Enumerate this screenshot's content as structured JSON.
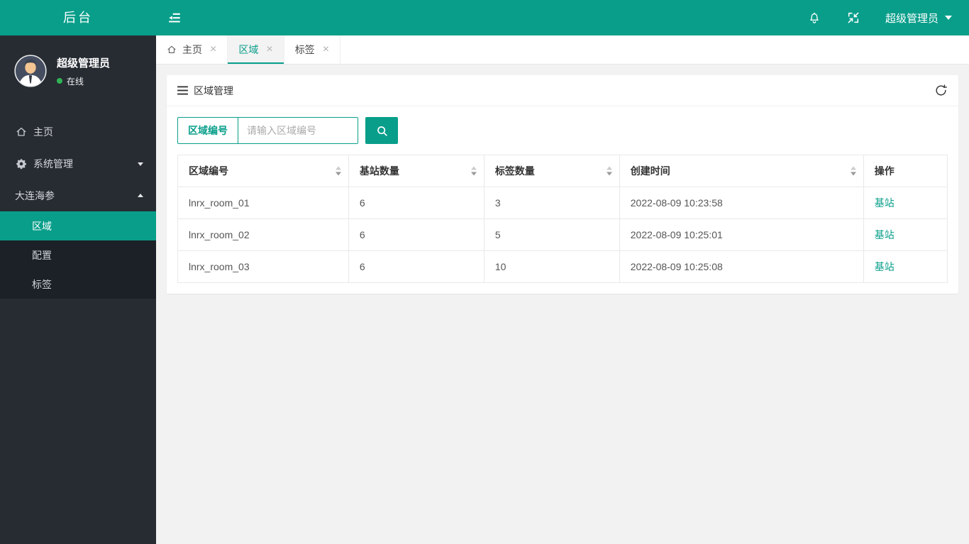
{
  "colors": {
    "accent": "#089e8a",
    "sidebar_bg": "#272c33",
    "submenu_bg": "#1c2127",
    "content_bg": "#f2f2f2",
    "online_dot_green": "#30b455",
    "link": "#089e8a"
  },
  "header": {
    "logo_text": "后台",
    "user_name": "超级管理员",
    "icons": [
      "sidebar-collapse-icon",
      "bell-icon",
      "exit-fullscreen-icon",
      "chevron-down-icon"
    ]
  },
  "sidebar": {
    "user": {
      "name": "超级管理员",
      "status": "在线"
    },
    "menu": [
      {
        "label": "主页",
        "icon": "home-icon"
      },
      {
        "label": "系统管理",
        "icon": "gear-icon",
        "state": "collapsed"
      },
      {
        "label": "大连海参",
        "state": "expanded",
        "children": [
          {
            "label": "区域",
            "active": true
          },
          {
            "label": "配置",
            "active": false
          },
          {
            "label": "标签",
            "active": false
          }
        ]
      }
    ]
  },
  "tabs": {
    "close_symbol": "×",
    "items": [
      {
        "label": "主页",
        "icon": "home-icon",
        "active": false
      },
      {
        "label": "区域",
        "active": true
      },
      {
        "label": "标签",
        "active": false
      }
    ]
  },
  "panel": {
    "title": "区域管理",
    "icons": [
      "list-icon",
      "refresh-icon"
    ],
    "search": {
      "field_label": "区域编号",
      "placeholder": "请输入区域编号",
      "button_icon": "search-icon"
    },
    "table": {
      "columns": [
        {
          "label": "区域编号",
          "sortable": true
        },
        {
          "label": "基站数量",
          "sortable": true
        },
        {
          "label": "标签数量",
          "sortable": true
        },
        {
          "label": "创建时间",
          "sortable": true
        },
        {
          "label": "操作",
          "sortable": false
        }
      ],
      "rows": [
        {
          "cells": [
            "lnrx_room_01",
            "6",
            "3",
            "2022-08-09 10:23:58"
          ],
          "action": "基站"
        },
        {
          "cells": [
            "lnrx_room_02",
            "6",
            "5",
            "2022-08-09 10:25:01"
          ],
          "action": "基站"
        },
        {
          "cells": [
            "lnrx_room_03",
            "6",
            "10",
            "2022-08-09 10:25:08"
          ],
          "action": "基站"
        }
      ]
    }
  }
}
